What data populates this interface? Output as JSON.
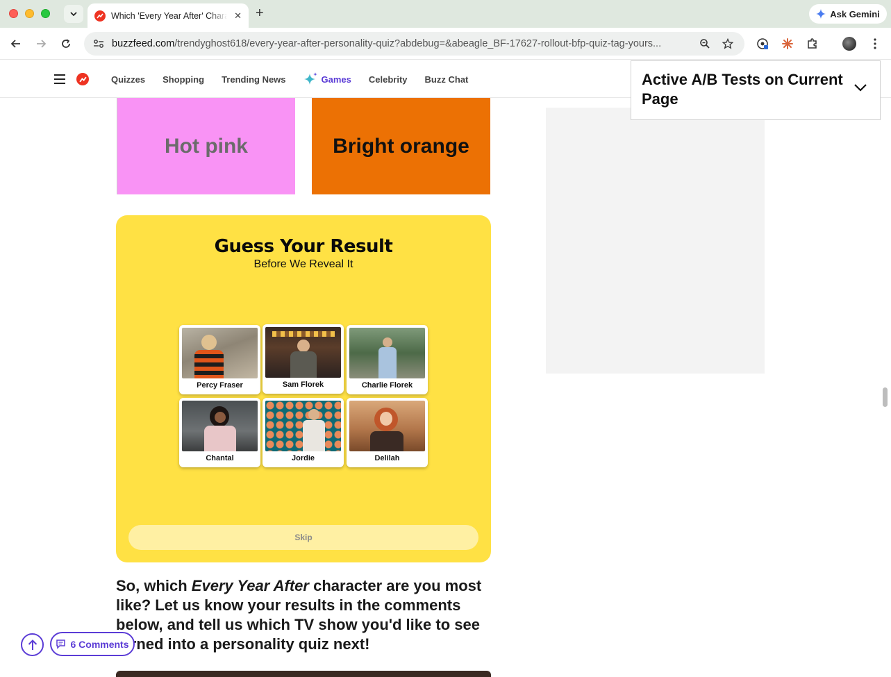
{
  "browser": {
    "tab_title": "Which 'Every Year After' Character",
    "ask_gemini": "Ask Gemini",
    "url_domain": "buzzfeed.com",
    "url_path": "/trendyghost618/every-year-after-personality-quiz?abdebug=&abeagle_BF-17627-rollout-bfp-quiz-tag-yours..."
  },
  "site_nav": {
    "links": [
      "Quizzes",
      "Shopping",
      "Trending News",
      "Games",
      "Celebrity",
      "Buzz Chat"
    ]
  },
  "ab_panel": {
    "title": "Active A/B Tests on Current Page"
  },
  "quiz": {
    "answers": [
      "Hot pink",
      "Bright orange"
    ],
    "answer_colors": [
      "#f993f5",
      "#ec7104"
    ]
  },
  "guess": {
    "title": "Guess Your Result",
    "subtitle": "Before We Reveal It",
    "characters": [
      "Percy Fraser",
      "Sam Florek",
      "Charlie Florek",
      "Chantal",
      "Jordie",
      "Delilah"
    ],
    "skip_label": "Skip"
  },
  "conclusion": {
    "before": "So, which ",
    "show": "Every Year After",
    "after": " character are you most like? Let us know your results in the comments below, and tell us which TV show you'd like to see turned into a personality quiz next!"
  },
  "comments": {
    "label": "6 Comments"
  },
  "colors": {
    "accent": "#5b3cd6",
    "card_yellow": "#ffe144",
    "brand_red": "#ee3322"
  }
}
